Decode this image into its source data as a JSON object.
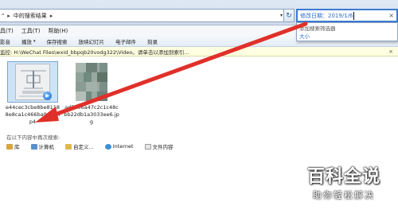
{
  "address": {
    "path_prefix": "\"",
    "path_label": "中的搜索结果",
    "separator": "▸",
    "dropdown": "▾"
  },
  "refresh_icon": "↻",
  "search": {
    "value": "修改日期：2019/1/6",
    "close_glyph": "×"
  },
  "suggest": {
    "hint": "添加搜索筛选器",
    "option": "大小"
  },
  "menu": {
    "items": [
      "具(T)",
      "工具(T)",
      "帮助(H)"
    ]
  },
  "toolbar": {
    "items": [
      "影音",
      "播放",
      "保存搜索",
      "放映幻灯片",
      "电子邮件",
      "刻录"
    ],
    "dropdown": "▾"
  },
  "info_bar": {
    "text": "监控: H:\\WeChat Files\\wxid_bbpqb20vodg322\\Video。请单击以添加到索引...",
    "close": "×"
  },
  "files": [
    {
      "name": "e44cec3cbe8be81188e8ca1c466ba9e3.mp4",
      "play_glyph": "▶"
    },
    {
      "name": "ad3106a47c2c1c48cbb22db1a3033ee6.jpg"
    }
  ],
  "search_again": {
    "label": "在以下内容中再次搜索:",
    "links": [
      {
        "label": "库",
        "color": "#d9a441"
      },
      {
        "label": "计算机",
        "color": "#5a8fcf"
      },
      {
        "label": "自定义...",
        "color": "#e0b84a"
      },
      {
        "label": "Internet",
        "color": "#3c8fd8"
      },
      {
        "label": "文件内容",
        "color": "#e7e7e7"
      }
    ]
  },
  "watermark": {
    "title": "百科全说",
    "subtitle": "助你轻松解决"
  },
  "colors": {
    "arrow": "#e0302a",
    "accent": "#3d7bd0"
  }
}
